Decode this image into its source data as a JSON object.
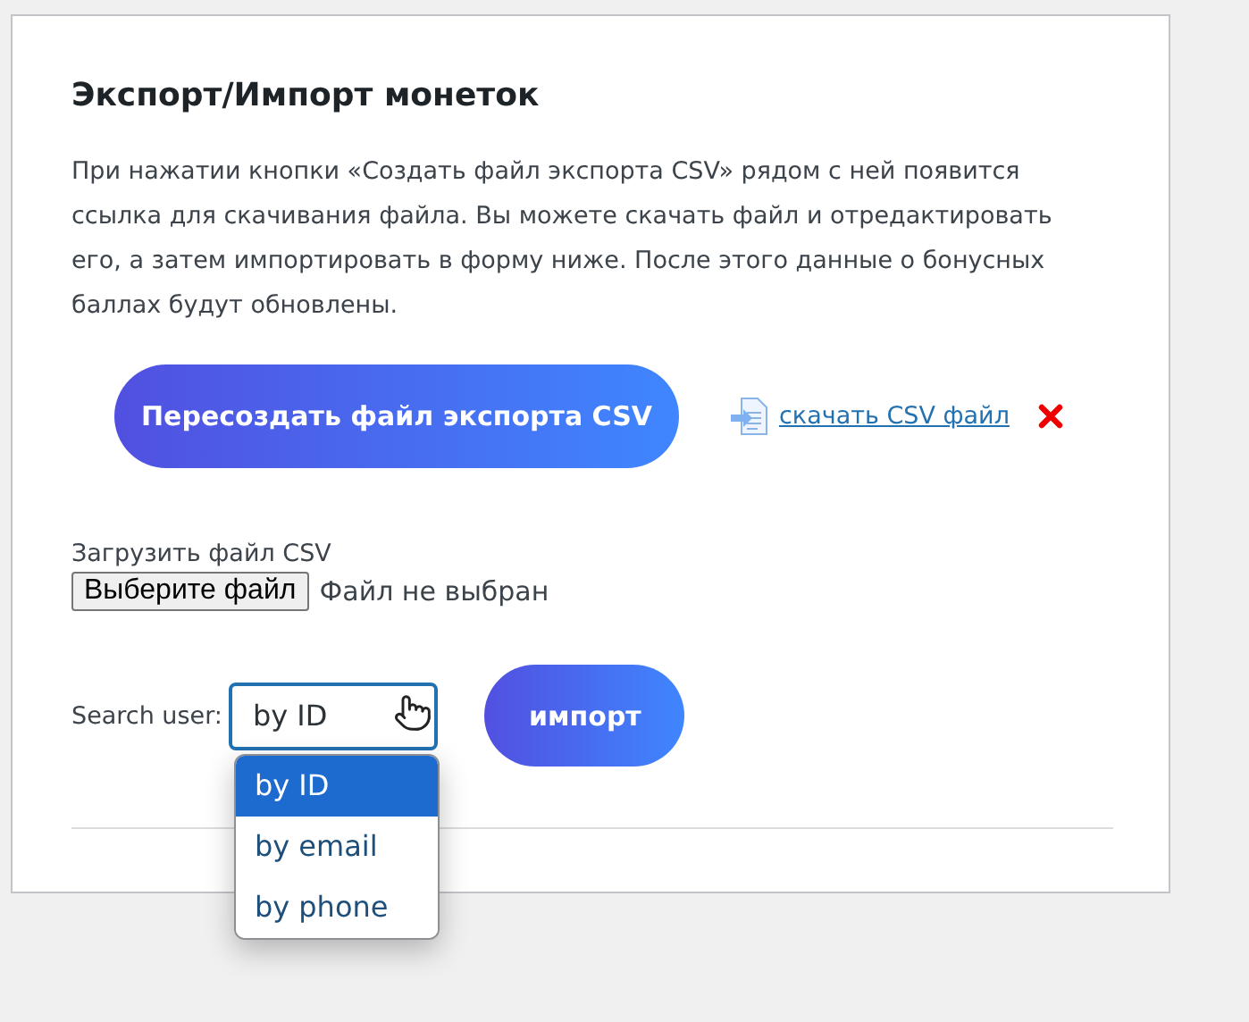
{
  "title": "Экспорт/Импорт монеток",
  "description": "При нажатии кнопки «Создать файл экспорта CSV» рядом с ней появится ссылка для скачивания файла. Вы можете скачать файл и отредактировать его, а затем импортировать в форму ниже. После этого данные о бонусных баллах будут обновлены.",
  "export_button": "Пересоздать файл экспорта CSV",
  "download_link": "скачать CSV файл",
  "upload": {
    "label": "Загрузить файл CSV",
    "button": "Выберите файл",
    "status": "Файл не выбран"
  },
  "search": {
    "label": "Search user:",
    "value": "by ID",
    "expanded": true,
    "options": [
      {
        "label": "by ID",
        "selected": true
      },
      {
        "label": "by email",
        "selected": false
      },
      {
        "label": "by phone",
        "selected": false
      }
    ]
  },
  "import_button": "импорт"
}
